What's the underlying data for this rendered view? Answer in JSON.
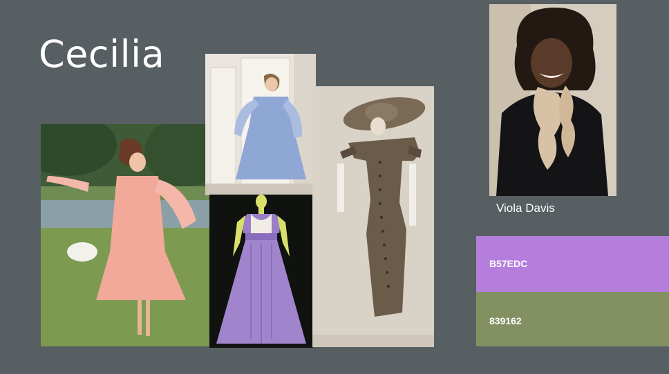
{
  "title": "Cecilia",
  "photos": [
    {
      "icon": "pink-pleated-dress-photo"
    },
    {
      "icon": "blue-full-skirt-dress-photo"
    },
    {
      "icon": "lavender-gown-mannequin-photo"
    },
    {
      "icon": "brown-button-dress-hat-photo"
    },
    {
      "icon": "actor-portrait-photo"
    }
  ],
  "actor": {
    "name": "Viola Davis"
  },
  "swatches": [
    {
      "label": "B57EDC",
      "color": "#B57EDC"
    },
    {
      "label": "839162",
      "color": "#839162"
    }
  ]
}
